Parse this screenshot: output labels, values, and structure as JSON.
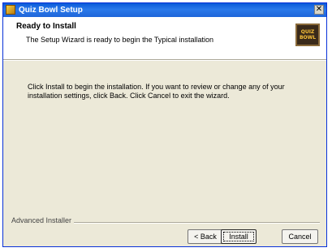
{
  "window": {
    "title": "Quiz Bowl Setup",
    "close_glyph": "✕",
    "app_icon": "setup-icon"
  },
  "banner": {
    "title": "Ready to Install",
    "subtitle": "The Setup Wizard is ready to begin the Typical installation",
    "logo_text": "QUIZ\nBOWL"
  },
  "main": {
    "message": "Click Install to begin the installation.  If you want to review or change any of your installation settings, click Back.  Click Cancel to exit the wizard."
  },
  "footer": {
    "brand": "Advanced Installer",
    "back_label": "< Back",
    "install_label": "Install",
    "cancel_label": "Cancel"
  },
  "colors": {
    "titlebar": "#1e66d9",
    "dialog_bg": "#ece9d8",
    "banner_bg": "#ffffff",
    "logo_text": "#f8c038"
  }
}
